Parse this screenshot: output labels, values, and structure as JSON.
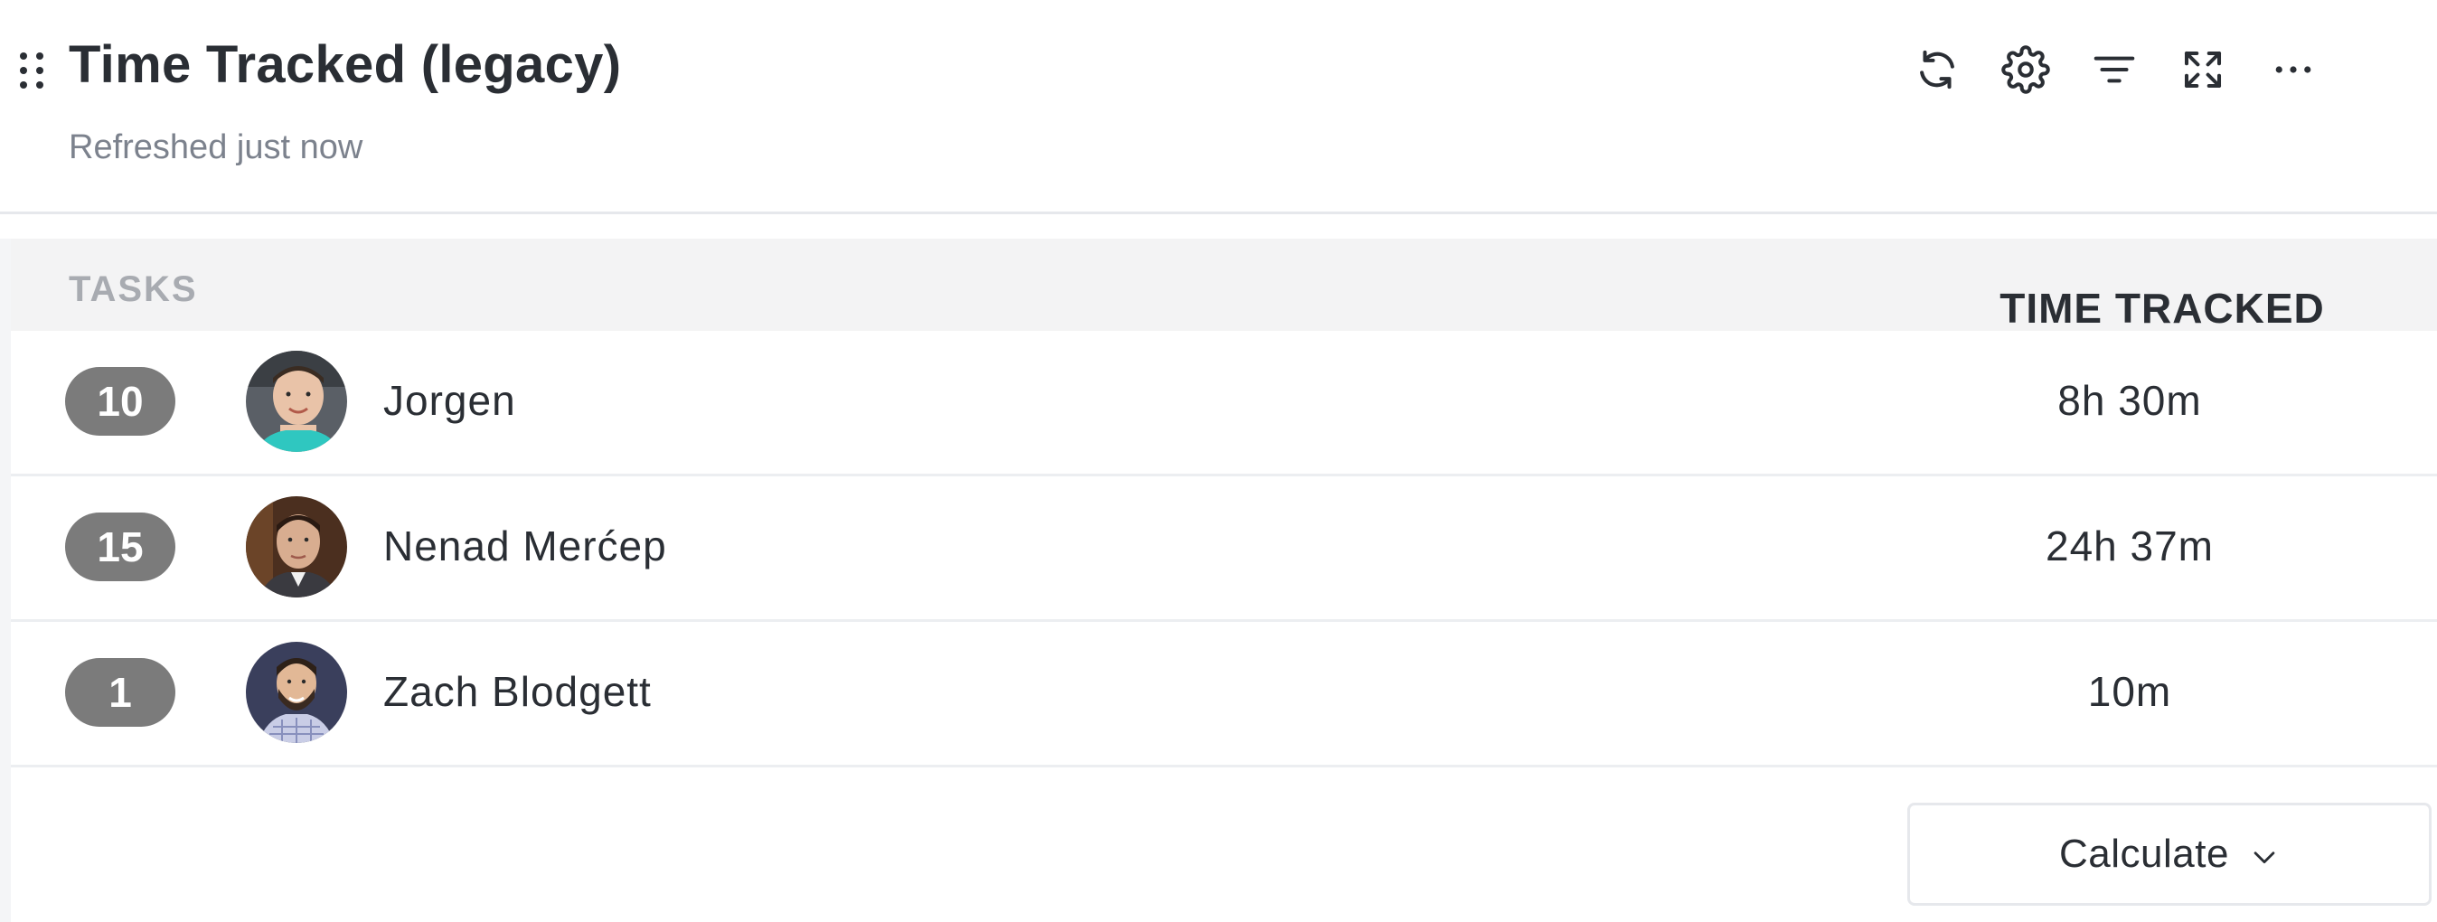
{
  "widget": {
    "title": "Time Tracked (legacy)",
    "subtitle": "Refreshed just now",
    "toolbar": {
      "refresh_icon": "refresh-icon",
      "settings_icon": "gear-icon",
      "filter_icon": "filter-icon",
      "expand_icon": "expand-icon",
      "more_icon": "more-horizontal-icon"
    }
  },
  "table": {
    "columns": {
      "tasks": "TASKS",
      "time_tracked": "TIME TRACKED"
    },
    "rows": [
      {
        "count": "10",
        "name": "Jorgen",
        "time": "8h 30m"
      },
      {
        "count": "15",
        "name": "Nenad Merćep",
        "time": "24h 37m"
      },
      {
        "count": "1",
        "name": "Zach Blodgett",
        "time": "10m"
      }
    ]
  },
  "footer": {
    "calculate_label": "Calculate"
  },
  "colors": {
    "badge": "#7b7b7b",
    "header_bg": "#f3f3f4",
    "text": "#2a2e34",
    "muted": "#7c828d"
  }
}
